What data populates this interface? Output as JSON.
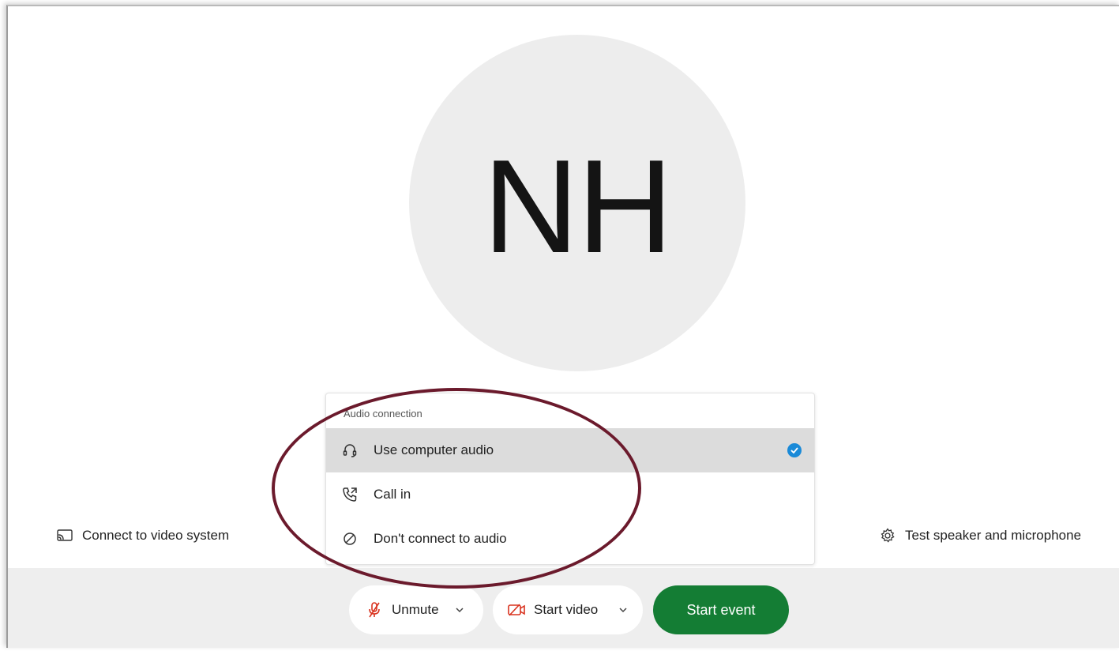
{
  "avatar": {
    "initials": "NH"
  },
  "left_link": {
    "label": "Connect to video system",
    "icon": "cast-screen-icon"
  },
  "right_link": {
    "label": "Test speaker and microphone",
    "icon": "gear-icon"
  },
  "audio_menu": {
    "header": "Audio connection",
    "items": [
      {
        "label": "Use computer audio",
        "icon": "headset-icon",
        "selected": true
      },
      {
        "label": "Call in",
        "icon": "phone-outgoing-icon",
        "selected": false
      },
      {
        "label": "Don't connect to audio",
        "icon": "prohibited-icon",
        "selected": false
      }
    ]
  },
  "controls": {
    "unmute_label": "Unmute",
    "start_video_label": "Start video",
    "start_event_label": "Start event"
  },
  "colors": {
    "start_event": "#147d34",
    "muted_red": "#d9331f",
    "check_blue": "#1a8ad8",
    "annotation_ring": "#6b1a2c"
  }
}
